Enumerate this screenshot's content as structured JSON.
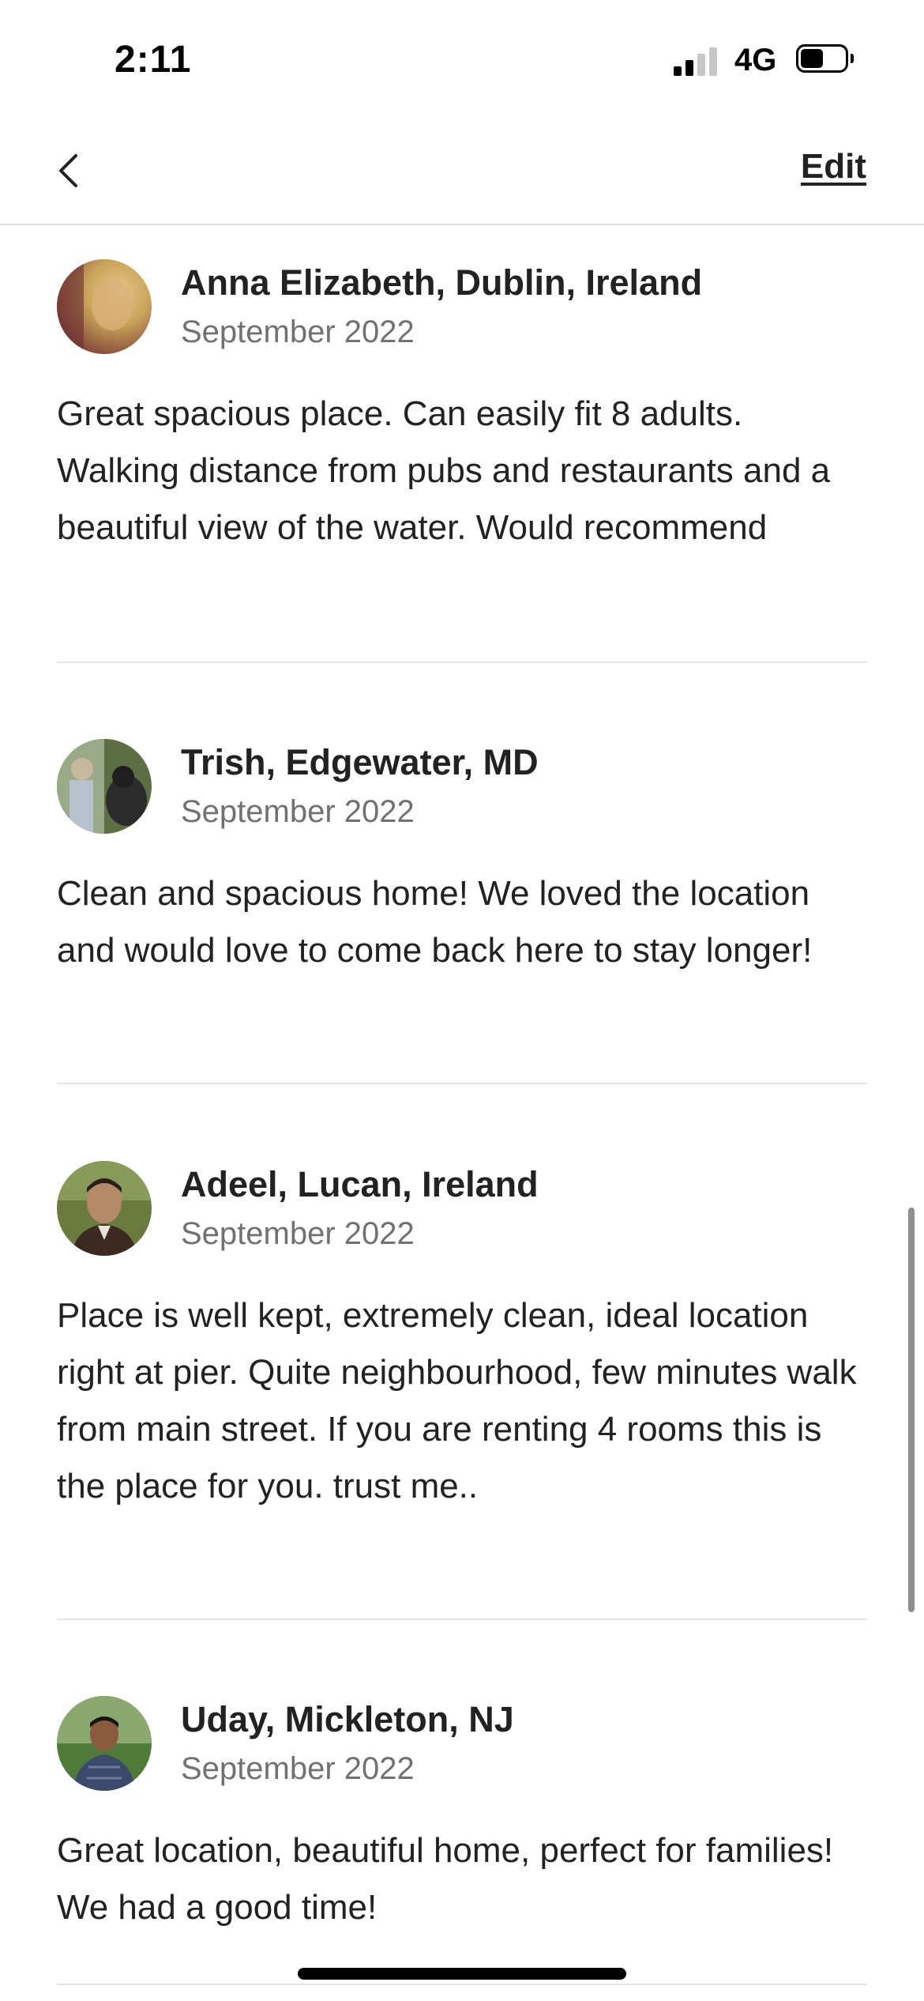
{
  "status_bar": {
    "time": "2:11",
    "network": "4G",
    "signal_bars_active": 2,
    "signal_bars_total": 4,
    "battery_level": 0.5
  },
  "nav": {
    "back_icon": "chevron-left-icon",
    "edit_label": "Edit"
  },
  "reviews": [
    {
      "name": "Anna Elizabeth, Dublin, Ireland",
      "date": "September 2022",
      "text": "Great spacious place. Can easily fit 8 adults. Walking distance from pubs and restaurants and a beautiful view of the water. Would recommend",
      "avatar_colors": [
        "#7a3a36",
        "#c9a45a",
        "#e8c88a"
      ]
    },
    {
      "name": "Trish, Edgewater, MD",
      "date": "September 2022",
      "text": "Clean and spacious home! We loved the location and would love to come back here to stay longer!",
      "avatar_colors": [
        "#5e6e44",
        "#9aaa88",
        "#2b2b2b"
      ]
    },
    {
      "name": "Adeel, Lucan, Ireland",
      "date": "September 2022",
      "text": "Place is well kept, extremely clean, ideal location right at pier. Quite neighbourhood, few minutes walk from main street. If you are renting 4 rooms this is the place for you. trust me..",
      "avatar_colors": [
        "#6b7a3e",
        "#b48a6a",
        "#3a2a22"
      ]
    },
    {
      "name": "Uday, Mickleton, NJ",
      "date": "September 2022",
      "text": "Great location, beautiful  home, perfect for families! We had a good time!",
      "avatar_colors": [
        "#4f7a3a",
        "#8aa870",
        "#3b4a6a"
      ]
    }
  ]
}
